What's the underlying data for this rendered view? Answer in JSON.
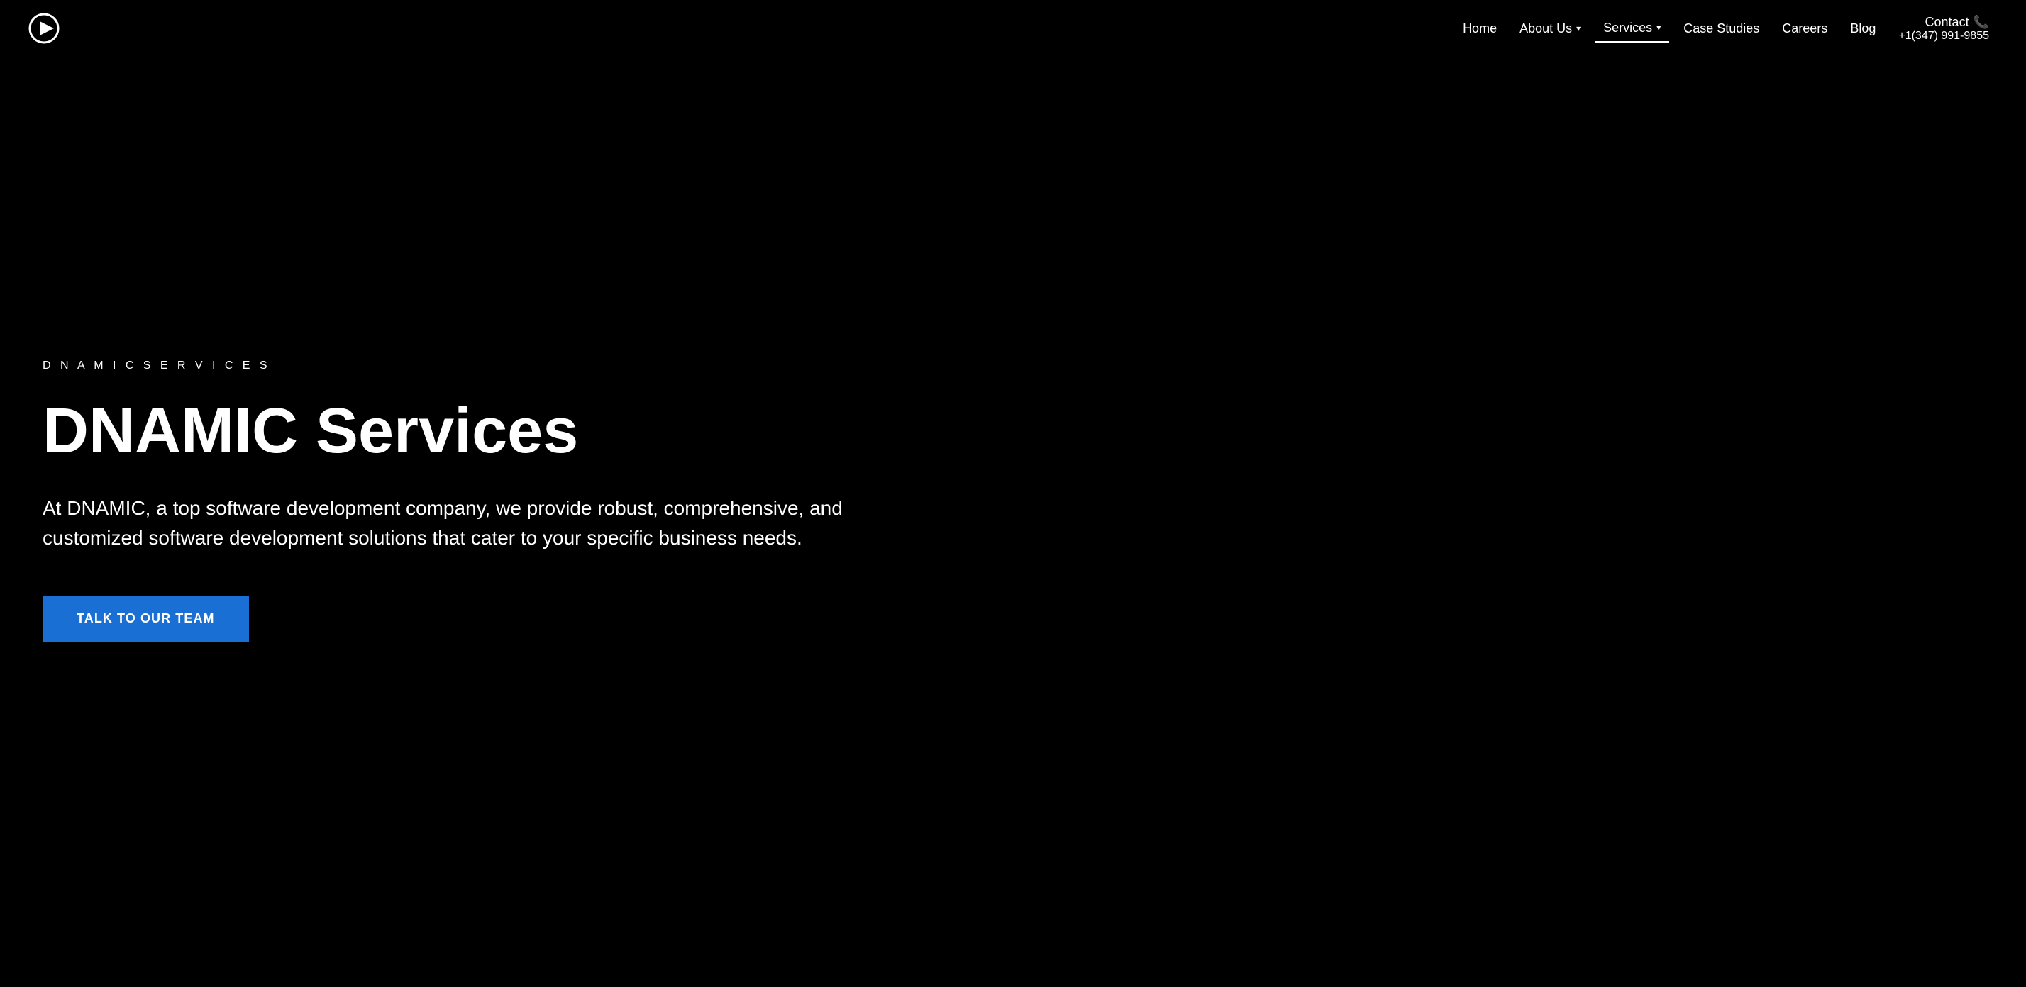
{
  "nav": {
    "logo_alt": "DNAMIC logo",
    "links": [
      {
        "label": "Home",
        "has_dropdown": false,
        "active": false,
        "id": "home"
      },
      {
        "label": "About Us",
        "has_dropdown": true,
        "active": false,
        "id": "about-us"
      },
      {
        "label": "Services",
        "has_dropdown": true,
        "active": true,
        "id": "services"
      },
      {
        "label": "Case Studies",
        "has_dropdown": false,
        "active": false,
        "id": "case-studies"
      },
      {
        "label": "Careers",
        "has_dropdown": false,
        "active": false,
        "id": "careers"
      },
      {
        "label": "Blog",
        "has_dropdown": false,
        "active": false,
        "id": "blog"
      }
    ],
    "contact_label": "Contact",
    "phone": "+1(347) 991-9855"
  },
  "hero": {
    "eyebrow": "D N A M I C   S E R V I C E S",
    "title": "DNAMIC Services",
    "description": "At DNAMIC, a top software development company, we provide robust, comprehensive, and customized software development solutions that cater to your specific business needs.",
    "cta_label": "TALK TO OUR TEAM"
  },
  "colors": {
    "background": "#000000",
    "cta_blue": "#1a6fd4",
    "text": "#ffffff"
  }
}
